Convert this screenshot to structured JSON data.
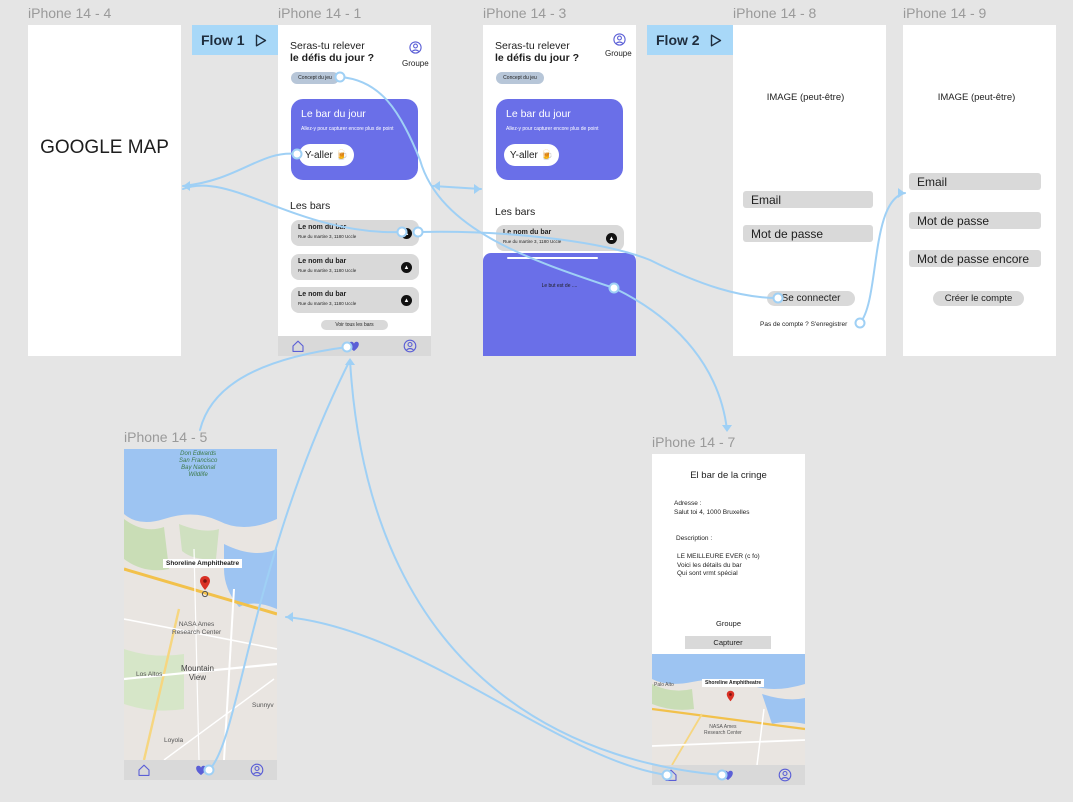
{
  "frames": {
    "f4": {
      "label": "iPhone 14 - 4",
      "title": "GOOGLE MAP"
    },
    "f1": {
      "label": "iPhone 14 - 1",
      "heading_line1": "Seras-tu relever",
      "heading_line2": "le défis du jour ?",
      "group_label": "Groupe",
      "concept_button": "Concept du jeu",
      "card_title": "Le bar du jour",
      "card_subtitle": "Allez-y pour capturer encore plus de point",
      "card_button": "Y-aller 🍺",
      "bars_title": "Les bars",
      "bars": [
        {
          "name": "Le nom du bar",
          "address": "Rue du martire 3, 1180 Uccle"
        },
        {
          "name": "Le nom du bar",
          "address": "Rue du martire 3, 1180 Uccle"
        },
        {
          "name": "Le nom du bar",
          "address": "Rue du martire 3, 1180 Uccle"
        }
      ],
      "see_all": "Voir tous les bars"
    },
    "f3": {
      "label": "iPhone 14 - 3",
      "heading_line1": "Seras-tu relever",
      "heading_line2": "le défis du jour ?",
      "group_label": "Groupe",
      "concept_button": "Concept du jeu",
      "card_title": "Le bar du jour",
      "card_subtitle": "Allez-y pour capturer encore plus de point",
      "card_button": "Y-aller 🍺",
      "bars_title": "Les bars",
      "bar_name": "Le nom du bar",
      "bar_address": "Rue du martire 3, 1180 Uccle",
      "sheet_text": "Le but est de ...."
    },
    "f8": {
      "label": "iPhone 14 - 8",
      "image_text": "IMAGE (peut-être)",
      "email": "Email",
      "password": "Mot de passe",
      "login_button": "Se connecter",
      "signup_link": "Pas de compte ? S'enregistrer"
    },
    "f9": {
      "label": "iPhone 14 - 9",
      "image_text": "IMAGE (peut-être)",
      "email": "Email",
      "password": "Mot de passe",
      "password_again": "Mot de passe encore",
      "create_button": "Créer le compte"
    },
    "f5": {
      "label": "iPhone 14 - 5",
      "map_labels": {
        "park": "Don Edwards\nSan Francisco\nBay National\nWildlife",
        "venue": "Shoreline Amphitheatre",
        "nasa": "NASA Ames\nResearch Center",
        "mountain_view": "Mountain\nView",
        "los_altos": "Los Altos",
        "sunnyvale": "Sunnyv",
        "loyola": "Loyola"
      }
    },
    "f7": {
      "label": "iPhone 14 - 7",
      "title": "El bar de la cringe",
      "address_label": "Adresse :",
      "address": "Salut toi 4, 1000 Bruxelles",
      "description_label": "Description :",
      "description": "LE MEILLEURE EVER (c fo)\nVoici les détails du bar\nQui sont vrmt spécial",
      "group": "Groupe",
      "capture_button": "Capturer",
      "map_labels": {
        "venue": "Shoreline Amphitheatre",
        "palo_alto": "Palo Alto",
        "nasa": "NASA Ames\nResearch Center"
      }
    }
  },
  "flows": [
    {
      "label": "Flow 1"
    },
    {
      "label": "Flow 2"
    }
  ],
  "colors": {
    "canvas": "#e5e5e5",
    "accent_purple": "#6a6fe8",
    "flow_tag": "#a8d8f8",
    "connector": "#9fd0f5",
    "field_grey": "#d9d9d9"
  },
  "icons": {
    "play": "play-icon",
    "user": "user-icon",
    "home": "home-icon",
    "heart": "heart-icon",
    "navigate": "navigate-icon",
    "map_pin": "map-pin-icon"
  }
}
